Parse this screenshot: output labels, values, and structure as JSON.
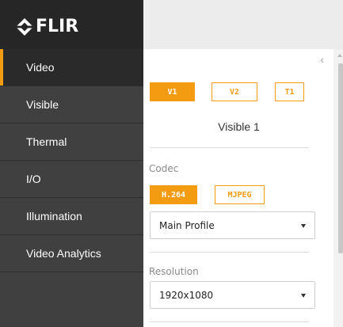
{
  "brand": {
    "logo_text": "FLIR"
  },
  "sidebar": {
    "items": [
      {
        "label": "Video",
        "active": true
      },
      {
        "label": "Visible"
      },
      {
        "label": "Thermal"
      },
      {
        "label": "I/O"
      },
      {
        "label": "Illumination"
      },
      {
        "label": "Video Analytics"
      }
    ]
  },
  "panel": {
    "collapse_glyph": "‹",
    "streams": [
      {
        "label": "V1",
        "selected": true
      },
      {
        "label": "V2"
      },
      {
        "label": "T1"
      }
    ],
    "stream_name": "Visible 1",
    "codec": {
      "label": "Codec",
      "options": [
        {
          "label": "H.264",
          "selected": true
        },
        {
          "label": "MJPEG"
        }
      ],
      "profile": "Main Profile"
    },
    "resolution": {
      "label": "Resolution",
      "value": "1920x1080"
    }
  },
  "colors": {
    "accent": "#f39c12",
    "sidebar_bg": "#404040",
    "logo_bg": "#262626"
  }
}
